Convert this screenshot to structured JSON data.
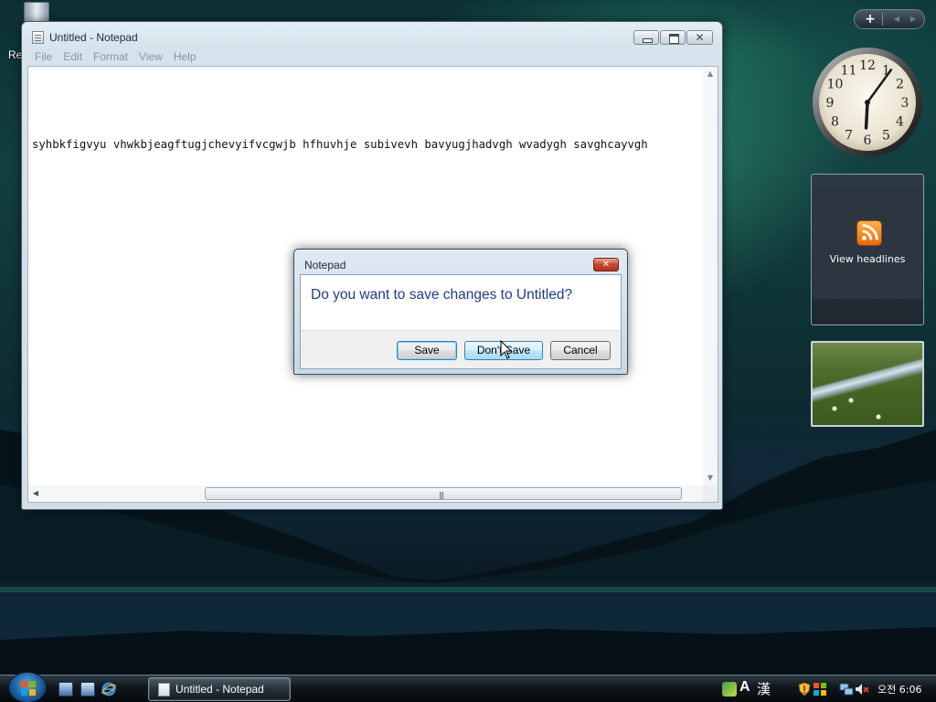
{
  "desktop": {
    "recycle_bin_label": "Re"
  },
  "notepad": {
    "title": "Untitled - Notepad",
    "menu": [
      "File",
      "Edit",
      "Format",
      "View",
      "Help"
    ],
    "content": "syhbkfigvyu vhwkbjeagftugjchevyifvcgwjb hfhuvhje subivevh bavyugjhadvgh wvadygh savghcayvgh",
    "close_glyph": "✕"
  },
  "dialog": {
    "title": "Notepad",
    "message": "Do you want to save changes to Untitled?",
    "buttons": {
      "save": "Save",
      "dont_save": "Don't Save",
      "cancel": "Cancel"
    },
    "close_glyph": "✕"
  },
  "sidebar": {
    "add_glyph": "+",
    "prev_glyph": "◀",
    "next_glyph": "▶",
    "clock": {
      "hour": 6,
      "minute": 6,
      "numerals": [
        "12",
        "1",
        "2",
        "3",
        "4",
        "5",
        "6",
        "7",
        "8",
        "9",
        "10",
        "11"
      ]
    },
    "feed": {
      "label": "View headlines"
    }
  },
  "taskbar": {
    "tasks": [
      {
        "label": "Untitled - Notepad"
      }
    ],
    "tray": {
      "ime_a": "A",
      "ime_han": "漢",
      "clock": "오전 6:06"
    }
  },
  "colors": {
    "dialog_message": "#1f3c8e",
    "feed_orange": "#f08a1c"
  }
}
